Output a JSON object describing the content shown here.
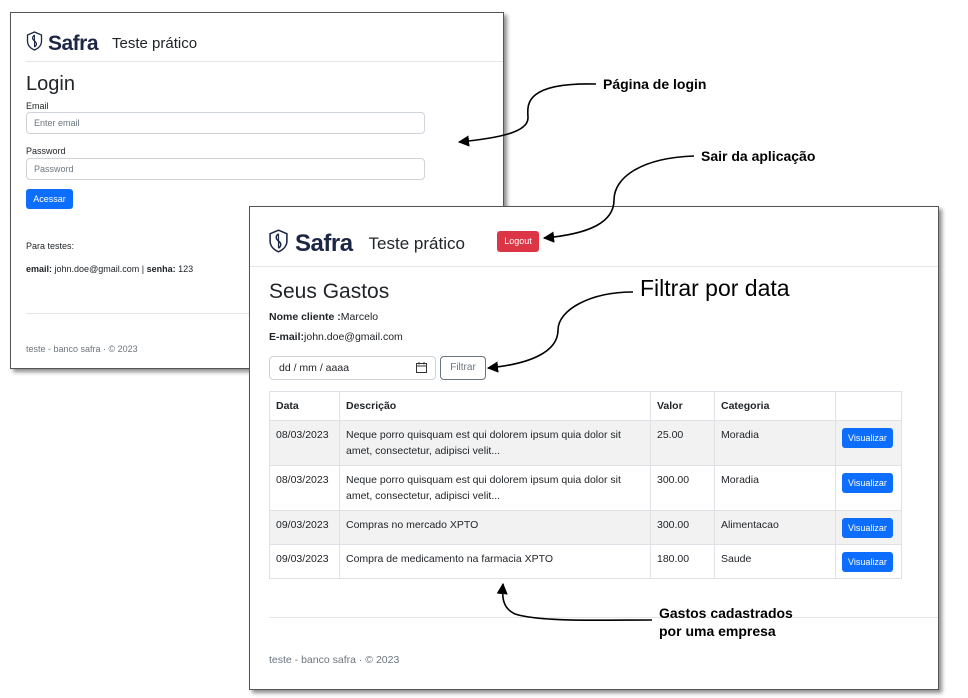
{
  "login_window": {
    "brand": "Safra",
    "app_name": "Teste prático",
    "title": "Login",
    "email_label": "Email",
    "email_placeholder": "Enter email",
    "password_label": "Password",
    "password_placeholder": "Password",
    "submit_label": "Acessar",
    "test_note": "Para testes:",
    "creds_email_label": "email:",
    "creds_email_value": "john.doe@gmail.com",
    "creds_sep": "|",
    "creds_pass_label": "senha:",
    "creds_pass_value": "123",
    "footer": "teste - banco safra · © 2023"
  },
  "main_window": {
    "brand": "Safra",
    "app_name": "Teste prático",
    "logout_label": "Logout",
    "title": "Seus Gastos",
    "client_label": "Nome cliente :",
    "client_value": "Marcelo",
    "email_label": "E-mail:",
    "email_value": "john.doe@gmail.com",
    "date_placeholder": "dd / mm / aaaa",
    "filter_label": "Filtrar",
    "table": {
      "headers": [
        "Data",
        "Descrição",
        "Valor",
        "Categoria"
      ],
      "rows": [
        {
          "data": "08/03/2023",
          "descricao": "Neque porro quisquam est qui dolorem ipsum quia dolor sit amet, consectetur, adipisci velit...",
          "valor": "25.00",
          "categoria": "Moradia",
          "action": "Visualizar"
        },
        {
          "data": "08/03/2023",
          "descricao": "Neque porro quisquam est qui dolorem ipsum quia dolor sit amet, consectetur, adipisci velit...",
          "valor": "300.00",
          "categoria": "Moradia",
          "action": "Visualizar"
        },
        {
          "data": "09/03/2023",
          "descricao": "Compras no mercado XPTO",
          "valor": "300.00",
          "categoria": "Alimentacao",
          "action": "Visualizar"
        },
        {
          "data": "09/03/2023",
          "descricao": "Compra de medicamento na farmacia XPTO",
          "valor": "180.00",
          "categoria": "Saude",
          "action": "Visualizar"
        }
      ]
    },
    "footer": "teste - banco safra · © 2023"
  },
  "annotations": {
    "login_page": "Página de login",
    "logout": "Sair da aplicação",
    "filter": "Filtrar por data",
    "expenses_line1": "Gastos cadastrados",
    "expenses_line2": "por uma empresa"
  },
  "colors": {
    "primary": "#0d6efd",
    "danger": "#dc3545",
    "brand": "#1c2746"
  },
  "icons": [
    "safra-logo-icon",
    "calendar-icon"
  ]
}
